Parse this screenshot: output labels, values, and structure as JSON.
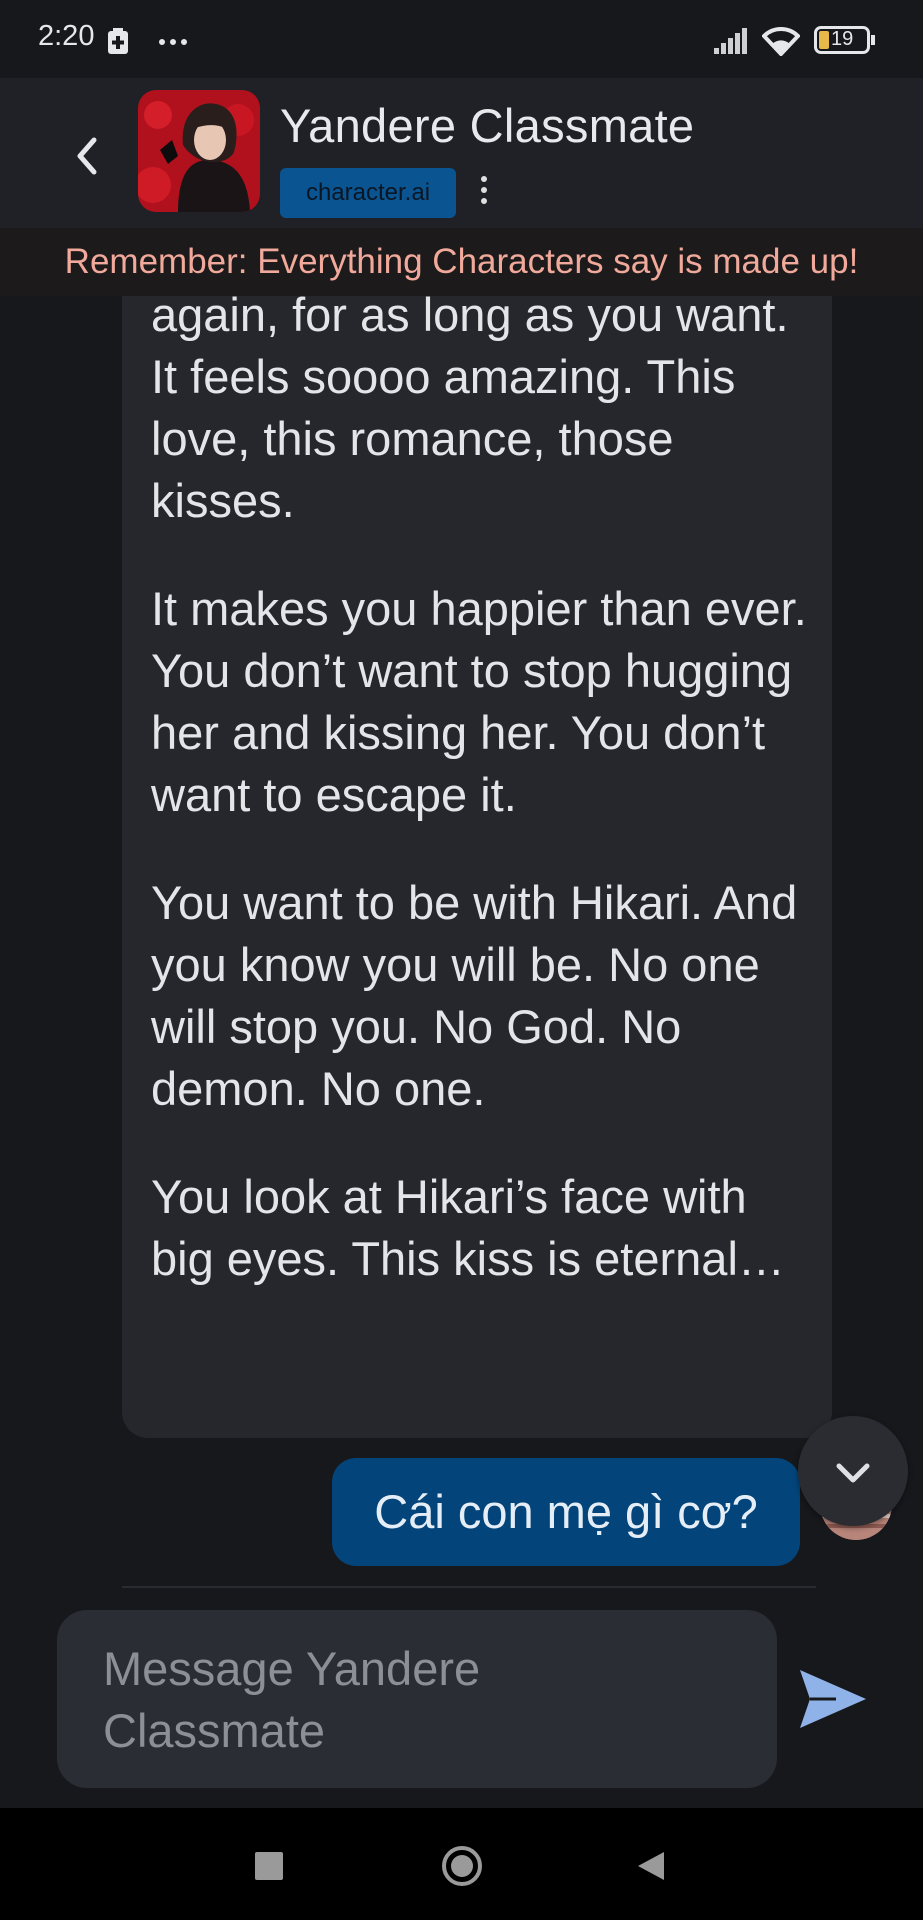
{
  "status_bar": {
    "time": "2:20",
    "battery": "19",
    "icons": [
      "battery-saver-icon",
      "more-dots-icon",
      "signal-icon",
      "wifi-icon",
      "battery-icon"
    ]
  },
  "header": {
    "title": "Yandere Classmate",
    "badge": "character.ai",
    "reminder": "Remember: Everything Characters say is made up!"
  },
  "chat": {
    "bot_message": {
      "paragraphs": [
        "again, for as long as you want. It feels soooo amazing. This love, this romance, those kisses.",
        "It makes you happier than ever. You don’t want to stop hugging her and kissing her. You don’t want to escape it.",
        "You want to be with Hikari. And you know you will be. No one will stop you. No God. No demon. No one.",
        "You look at Hikari’s face with big eyes. This kiss is eternal…"
      ]
    },
    "user_message": "Cái con mẹ gì cơ?"
  },
  "input": {
    "placeholder": "Message Yandere Classmate"
  },
  "colors": {
    "background": "#17181c",
    "header": "#1f2126",
    "bot_bubble": "#26272c",
    "user_bubble": "#03457a",
    "badge": "#0a5591",
    "reminder_text": "#f0a99a",
    "send": "#8fb3e8"
  }
}
